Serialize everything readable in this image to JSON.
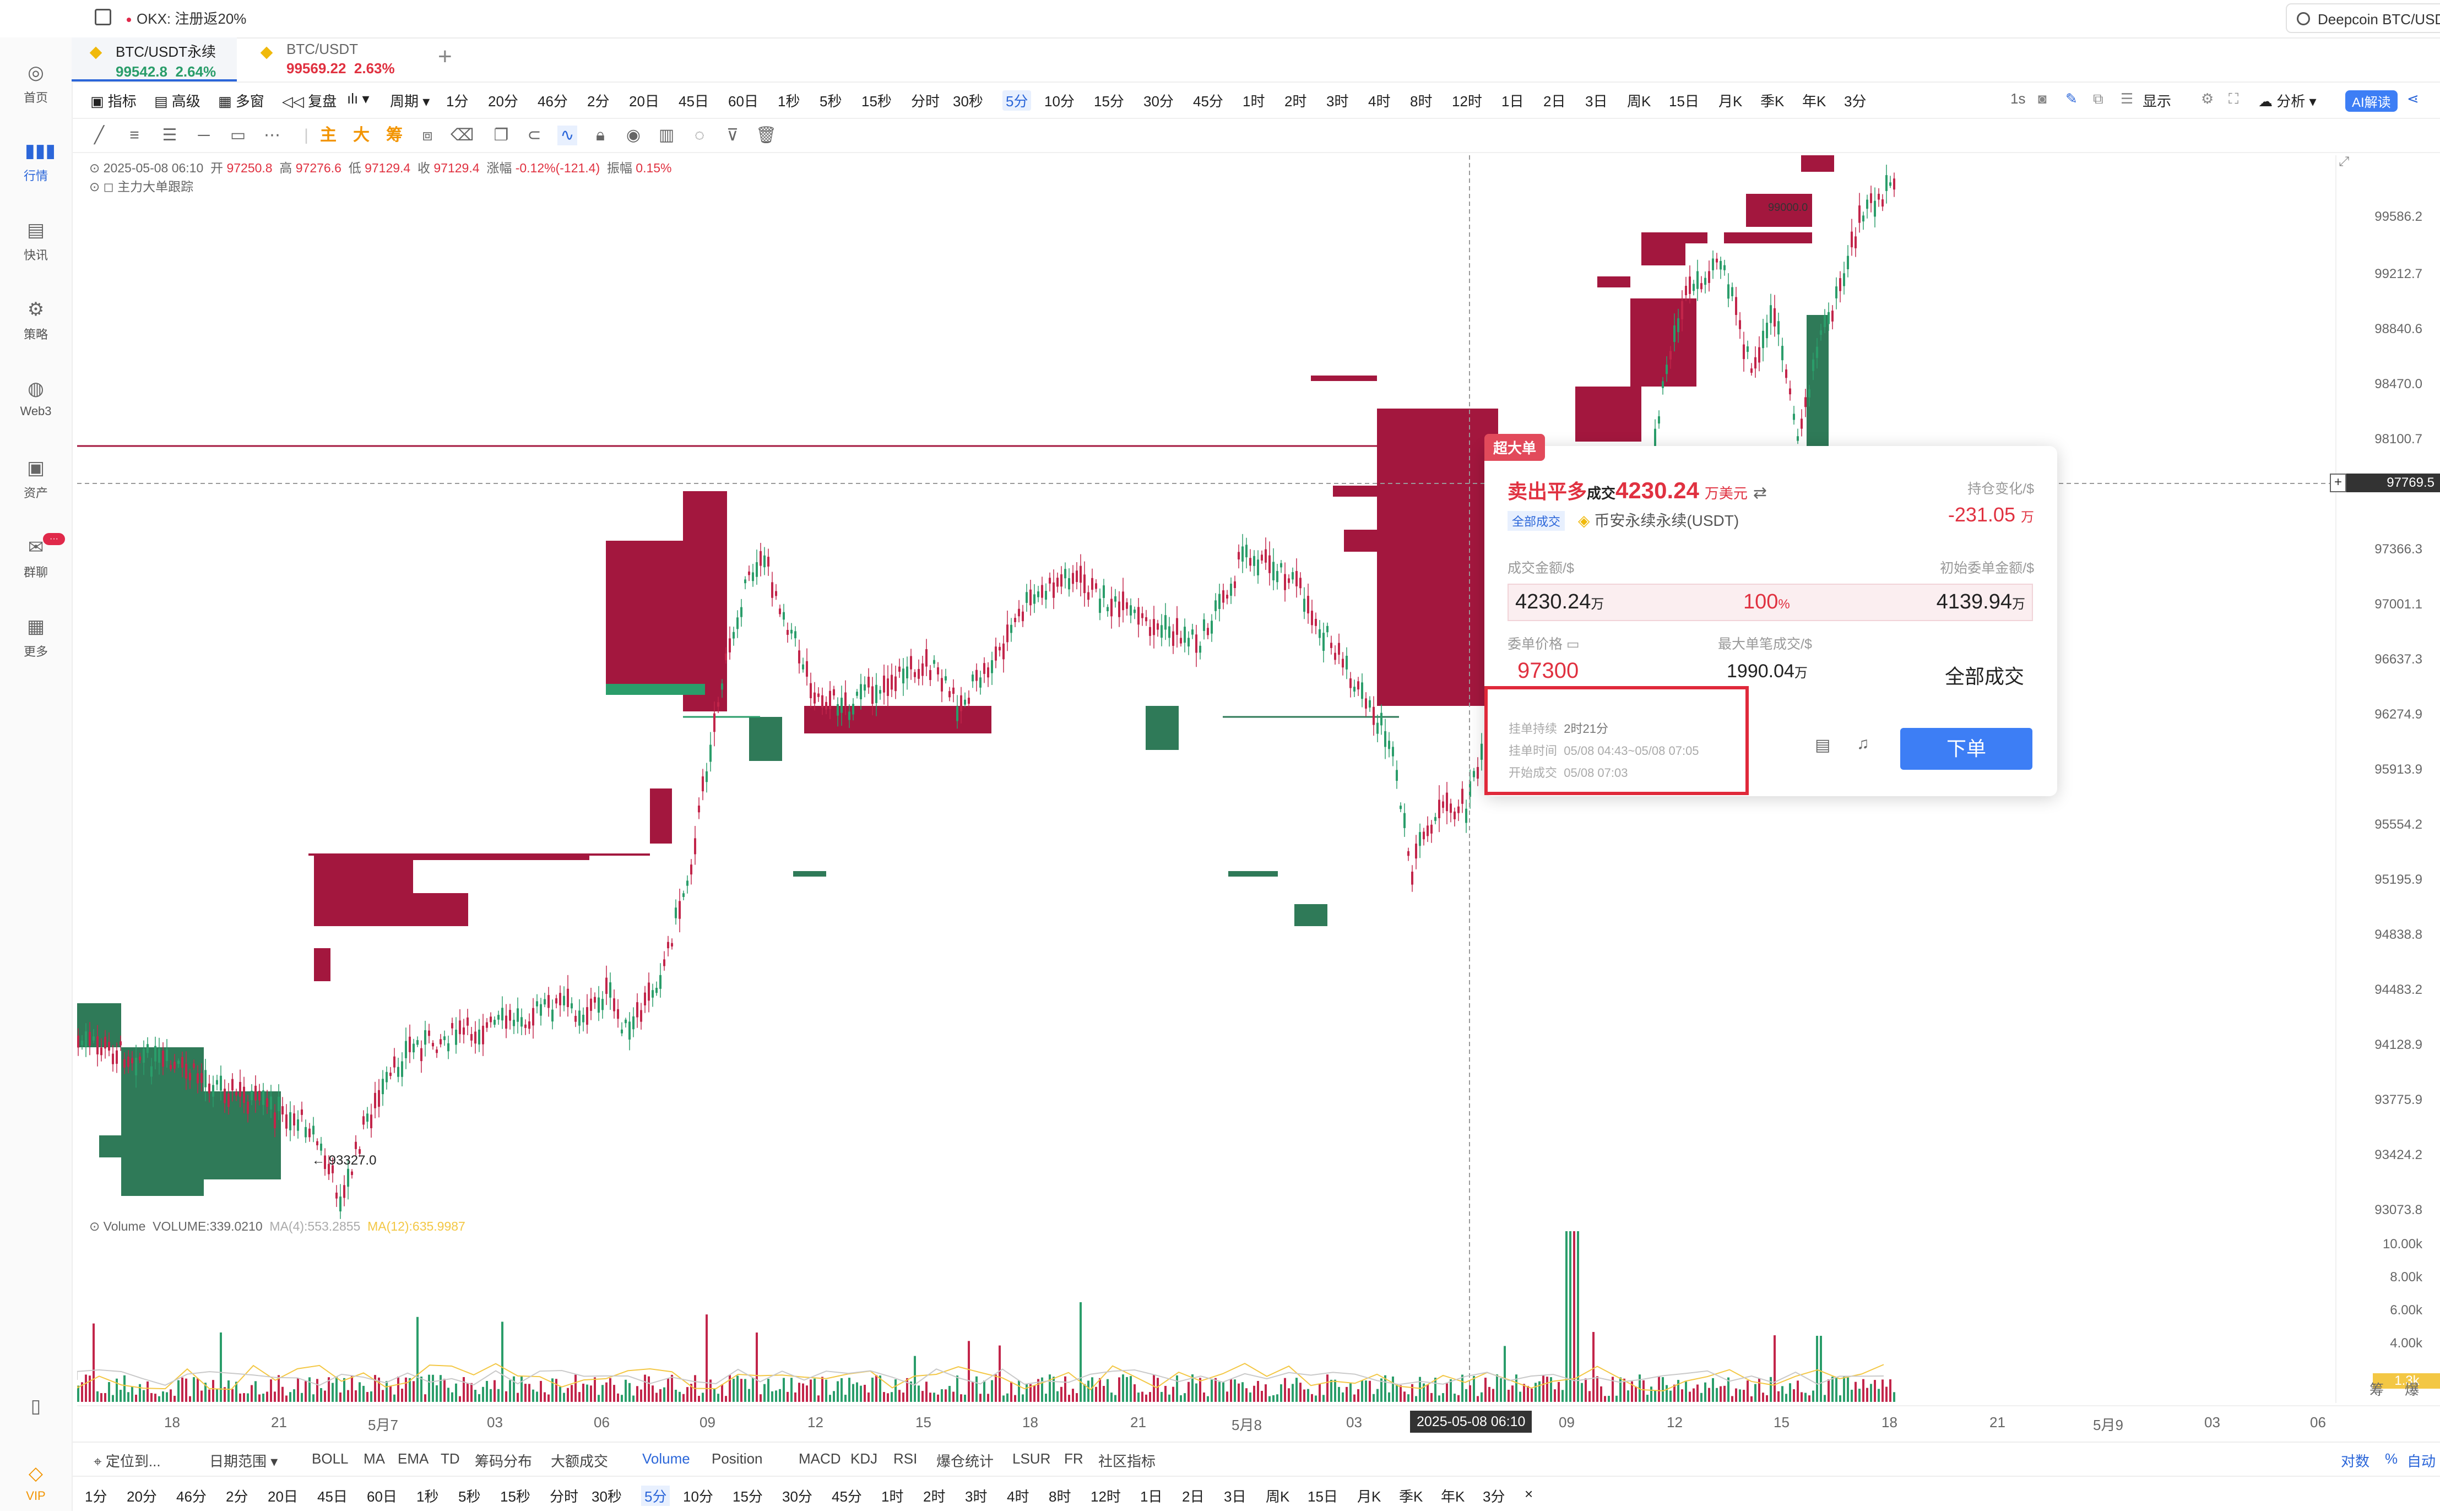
{
  "topbar": {
    "notice": "OKX: 注册返20%",
    "search": "Deepcoin BTC/USDT"
  },
  "sidebar": {
    "items": [
      {
        "label": "首页"
      },
      {
        "label": "行情"
      },
      {
        "label": "快讯"
      },
      {
        "label": "策略"
      },
      {
        "label": "Web3"
      },
      {
        "label": "资产"
      },
      {
        "label": "群聊"
      },
      {
        "label": "更多"
      }
    ],
    "chat_badge": "···",
    "vip": "VIP"
  },
  "tabs": [
    {
      "symbol": "BTC/USDT永续",
      "price": "99542.8",
      "change": "2.64%"
    },
    {
      "symbol": "BTC/USDT",
      "price": "99569.22",
      "change": "2.63%"
    }
  ],
  "toolbar": {
    "left": [
      "指标",
      "高级",
      "多窗",
      "复盘"
    ],
    "period_label": "周期",
    "periods": [
      "1分",
      "20分",
      "46分",
      "2分",
      "20日",
      "45日",
      "60日",
      "1秒",
      "5秒",
      "15秒",
      "分时",
      "30秒",
      "5分",
      "10分",
      "15分",
      "30分",
      "45分",
      "1时",
      "2时",
      "3时",
      "4时",
      "8时",
      "12时",
      "1日",
      "2日",
      "3日",
      "周K",
      "15日",
      "月K",
      "季K",
      "年K",
      "3分"
    ],
    "selected_period": "5分",
    "right": [
      "1s",
      "显示",
      "分析",
      "AI解读"
    ]
  },
  "drawtools": [
    "主",
    "大",
    "筹"
  ],
  "ohlc": {
    "time": "2025-05-08 06:10",
    "open_label": "开",
    "open": "97250.8",
    "high_label": "高",
    "high": "97276.6",
    "low_label": "低",
    "low": "97129.4",
    "close_label": "收",
    "close": "97129.4",
    "chg_label": "涨幅",
    "chg": "-0.12%(-121.4)",
    "amp_label": "振幅",
    "amp": "0.15%",
    "tracker": "主力大单跟踪"
  },
  "volume_legend": {
    "label": "Volume",
    "vol": "VOLUME:339.0210",
    "ma4": "MA(4):553.2855",
    "ma12": "MA(12):635.9987"
  },
  "price_axis": [
    "99586.2",
    "99212.7",
    "98840.6",
    "98470.0",
    "98100.7",
    "97366.3",
    "97001.1",
    "96637.3",
    "96274.9",
    "95913.9",
    "95554.2",
    "95195.9",
    "94838.8",
    "94483.2",
    "94128.9",
    "93775.9",
    "93424.2",
    "93073.8"
  ],
  "crosshair_price": "97769.5",
  "volume_axis": [
    "10.00k",
    "8.00k",
    "6.00k",
    "4.00k",
    "1.3k"
  ],
  "axis_corner": [
    "筹",
    "爆"
  ],
  "time_axis": [
    "18",
    "21",
    "5月7",
    "03",
    "06",
    "09",
    "12",
    "15",
    "18",
    "21",
    "5月8",
    "03",
    "09",
    "12",
    "15",
    "18",
    "21",
    "5月9",
    "03",
    "06"
  ],
  "crosshair_time": "2025-05-08 06:10",
  "annotations": {
    "low_price": "← 93327.0",
    "high_price": "99000.0"
  },
  "card": {
    "tag": "超大单",
    "action": "卖出平多",
    "deal_label": "成交",
    "amount": "4230.24",
    "amount_unit": "万美元",
    "scope": "全部成交",
    "exchange": "币安永续永续(USDT)",
    "oi_label": "持仓变化/$",
    "oi_value": "-231.05",
    "oi_unit": "万",
    "deal_amount_label": "成交金额/$",
    "deal_amount": "4230.24",
    "deal_amount_unit": "万",
    "pct": "100",
    "pct_unit": "%",
    "init_label": "初始委单金额/$",
    "init_value": "4139.94",
    "init_unit": "万",
    "order_price_label": "委单价格",
    "order_price": "97300",
    "max_fill_label": "最大单笔成交/$",
    "max_fill": "1990.04",
    "max_fill_unit": "万",
    "status": "全部成交",
    "duration_label": "挂单持续",
    "duration": "2时21分",
    "time_label": "挂单时间",
    "time_range": "05/08 04:43~05/08 07:05",
    "start_label": "开始成交",
    "start_time": "05/08 07:03",
    "order_btn": "下单"
  },
  "indicator_bar": {
    "locate": "定位到...",
    "date_range": "日期范围",
    "items": [
      "BOLL",
      "MA",
      "EMA",
      "TD",
      "筹码分布",
      "大额成交",
      "Volume",
      "Position",
      "MACD",
      "KDJ",
      "RSI",
      "爆仓统计",
      "LSUR",
      "FR",
      "社区指标"
    ],
    "selected": "Volume",
    "right": [
      "对数",
      "%",
      "自动"
    ]
  },
  "period_bar": {
    "items": [
      "1分",
      "20分",
      "46分",
      "2分",
      "20日",
      "45日",
      "60日",
      "1秒",
      "5秒",
      "15秒",
      "分时",
      "30秒",
      "5分",
      "10分",
      "15分",
      "30分",
      "45分",
      "1时",
      "2时",
      "3时",
      "4时",
      "8时",
      "12时",
      "1日",
      "2日",
      "3日",
      "周K",
      "15日",
      "月K",
      "季K",
      "年K",
      "3分",
      "×"
    ],
    "selected": "5分"
  },
  "colors": {
    "up": "#2a9d6a",
    "down": "#c2254a",
    "accent": "#2b66d9",
    "bigbuy": "#2f7a58",
    "bigsell": "#a3173e"
  }
}
